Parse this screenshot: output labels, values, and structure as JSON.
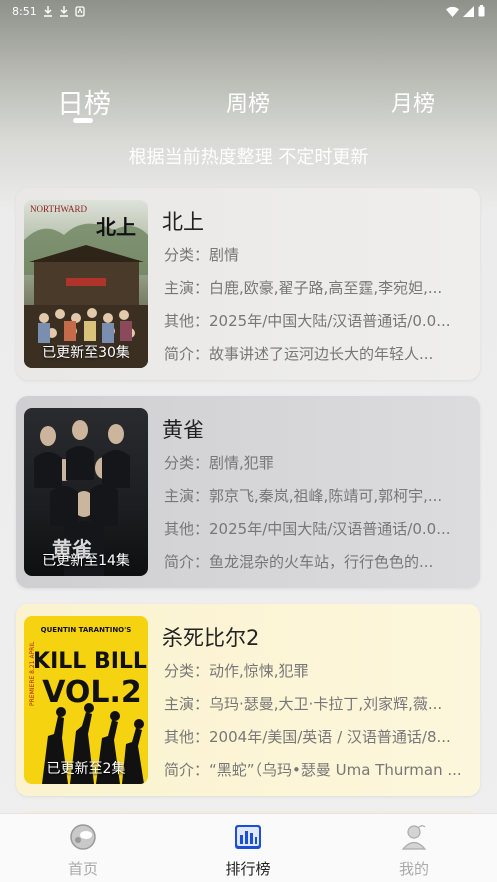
{
  "status_bar": {
    "time": "8:51"
  },
  "tabs": [
    {
      "label": "日榜",
      "active": true
    },
    {
      "label": "周榜",
      "active": false
    },
    {
      "label": "月榜",
      "active": false
    }
  ],
  "subtitle": "根据当前热度整理 不定时更新",
  "labels": {
    "category": "分类：",
    "cast": "主演：",
    "other": "其他：",
    "intro": "简介："
  },
  "items": [
    {
      "title": "北上",
      "poster_text": "北上",
      "poster_top_text": "NORTHWARD",
      "update": "已更新至30集",
      "category": "剧情",
      "cast": "白鹿,欧豪,翟子路,高至霆,李宛妲,...",
      "other": "2025年/中国大陆/汉语普通话/0.0...",
      "intro": "故事讲述了运河边长大的年轻人..."
    },
    {
      "title": "黄雀",
      "poster_text": "黄雀",
      "update": "已更新至14集",
      "category": "剧情,犯罪",
      "cast": "郭京飞,秦岚,祖峰,陈靖可,郭柯宇,...",
      "other": "2025年/中国大陆/汉语普通话/0.0...",
      "intro": "鱼龙混杂的火车站，行行色色的..."
    },
    {
      "title": "杀死比尔2",
      "poster_text_1": "KILL BILL",
      "poster_text_2": "VOL.2",
      "poster_top_text": "QUENTIN TARANTINO'S",
      "poster_side_text": "PREMIERE 8.21 APRIL",
      "update": "已更新至2集",
      "category": "动作,惊悚,犯罪",
      "cast": "乌玛·瑟曼,大卫·卡拉丁,刘家辉,薇...",
      "other": "2004年/美国/英语 / 汉语普通话/8...",
      "intro": "“黑蛇”（乌玛•瑟曼 Uma Thurman ..."
    }
  ],
  "bottom_nav": [
    {
      "label": "首页",
      "icon": "home-icon",
      "active": false
    },
    {
      "label": "排行榜",
      "icon": "ranking-chart-icon",
      "active": true
    },
    {
      "label": "我的",
      "icon": "profile-icon",
      "active": false
    }
  ],
  "colors": {
    "accent": "#1a4fd6",
    "kill_bill_yellow": "#f5d310",
    "text_gray": "#777777"
  }
}
